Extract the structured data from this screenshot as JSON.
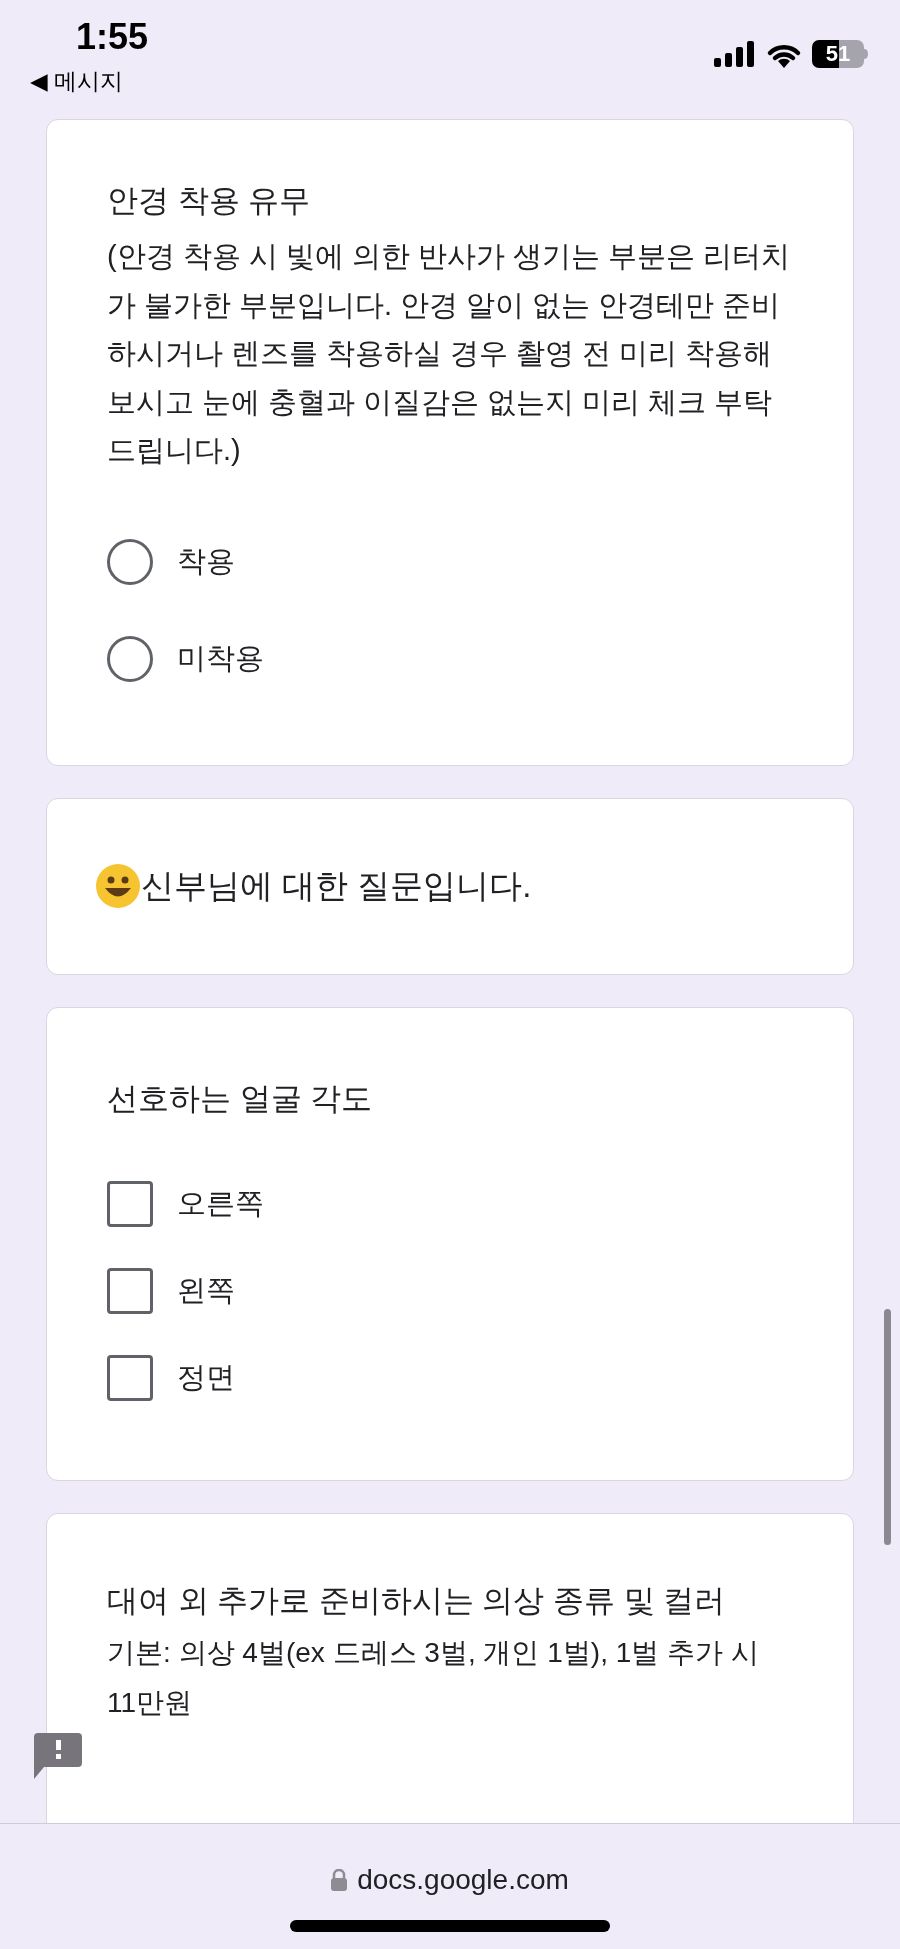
{
  "status_bar": {
    "time": "1:55",
    "back_label": "◀ 메시지",
    "battery": "51"
  },
  "cards": [
    {
      "kind": "radio",
      "title": "안경 착용 유무",
      "description": "(안경 착용 시 빛에 의한 반사가 생기는 부분은 리터치가 불가한 부분입니다. 안경 알이 없는 안경테만 준비하시거나 렌즈를 착용하실 경우 촬영 전 미리 착용해보시고 눈에 충혈과 이질감은 없는지 미리 체크 부탁드립니다.)",
      "options": [
        {
          "label": "착용",
          "selected": false
        },
        {
          "label": "미착용",
          "selected": false
        }
      ]
    },
    {
      "kind": "section",
      "title": "신부님에 대한 질문입니다."
    },
    {
      "kind": "checkbox",
      "title": "선호하는 얼굴 각도",
      "options": [
        {
          "label": "오른쪽",
          "checked": false
        },
        {
          "label": "왼쪽",
          "checked": false
        },
        {
          "label": "정면",
          "checked": false
        }
      ]
    },
    {
      "kind": "text",
      "title": "대여 외 추가로 준비하시는 의상 종류 및 컬러",
      "description": "기본: 의상 4벌(ex 드레스 3벌, 개인 1벌), 1벌 추가 시 11만원"
    }
  ],
  "address_bar": {
    "url": "docs.google.com"
  }
}
